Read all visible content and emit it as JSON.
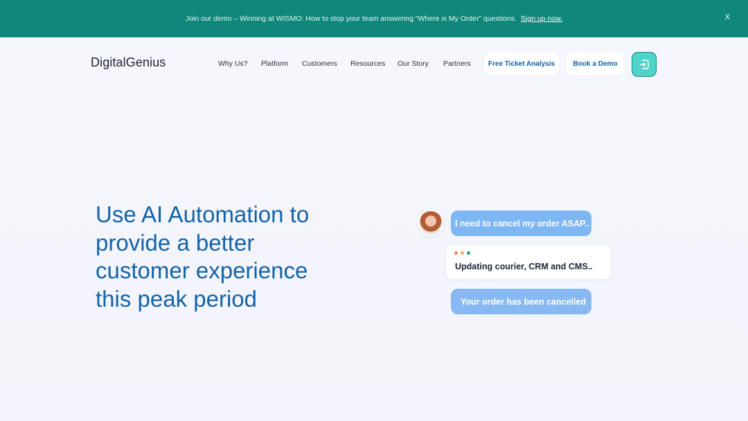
{
  "banner": {
    "message": "Join our demo – Winning at WISMO: How to stop your team answering “Where is My Order” questions.",
    "cta": "Sign up now.",
    "close_label": "X"
  },
  "header": {
    "logo_light": "Digital",
    "logo_bold": "Genius",
    "nav": [
      "Why Us?",
      "Platform",
      "Customers",
      "Resources",
      "Our Story",
      "Partners"
    ],
    "free_ticket_label": "Free Ticket Analysis",
    "book_demo_label": "Book a Demo",
    "login_icon": "login-icon"
  },
  "hero": {
    "title": "Use AI Automation to provide a better customer experience this peak period"
  },
  "chat": {
    "user_message": "I need to cancel my order ASAP..",
    "status_message": "Updating courier, CRM and CMS..",
    "bot_message": "Your order has been cancelled",
    "dot_colors": [
      "#f08a5d",
      "#f5a45a",
      "#1aa39a"
    ]
  },
  "colors": {
    "banner": "#0f877a",
    "accent": "#1463a8",
    "login_button": "#4fd4cc",
    "bubble": "#7eb7f4"
  }
}
